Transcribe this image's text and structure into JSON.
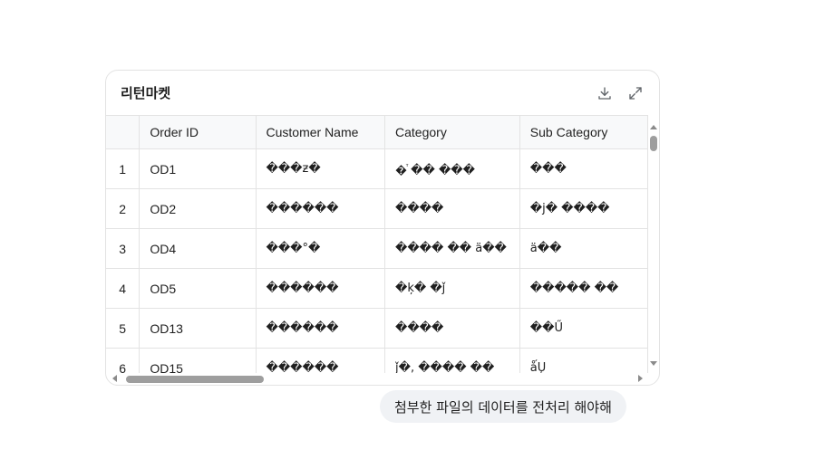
{
  "card": {
    "title": "리턴마켓",
    "download_icon": "download-icon",
    "expand_icon": "expand-icon"
  },
  "table": {
    "columns": [
      "",
      "Order ID",
      "Customer Name",
      "Category",
      "Sub Category"
    ],
    "rows": [
      [
        "1",
        "OD1",
        "���ƶ�",
        "�ⷮ �� ���",
        "���"
      ],
      [
        "2",
        "OD2",
        "������",
        "����",
        "�ј� ����"
      ],
      [
        "3",
        "OD4",
        "���°�",
        "���� �� ä��",
        "ä��"
      ],
      [
        "4",
        "OD5",
        "������",
        "�ķ� �ǰ",
        "����� ��"
      ],
      [
        "5",
        "OD13",
        "������",
        "����",
        "��Ű"
      ],
      [
        "6",
        "OD15",
        "������",
        "ǰ�, ���� ��",
        "ǻŲ"
      ]
    ]
  },
  "message": {
    "text": "첨부한 파일의 데이터를 전처리 해야해"
  }
}
